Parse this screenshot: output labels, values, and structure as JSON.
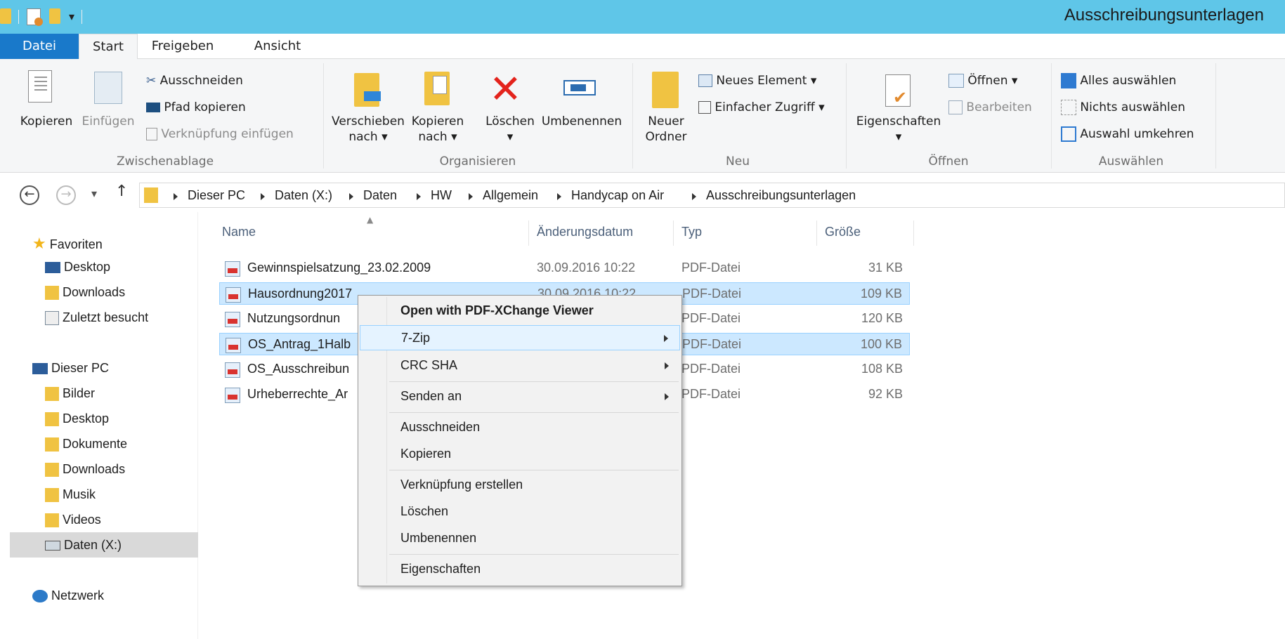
{
  "window": {
    "title": "Ausschreibungsunterlagen"
  },
  "tabs": [
    {
      "label": "Datei"
    },
    {
      "label": "Start"
    },
    {
      "label": "Freigeben"
    },
    {
      "label": "Ansicht"
    }
  ],
  "ribbon": {
    "clipboard": {
      "group": "Zwischenablage",
      "copy": "Kopieren",
      "paste": "Einfügen",
      "cut": "Ausschneiden",
      "copy_path": "Pfad kopieren",
      "paste_shortcut": "Verknüpfung einfügen"
    },
    "organize": {
      "group": "Organisieren",
      "move_to_1": "Verschieben",
      "move_to_2": "nach",
      "copy_to_1": "Kopieren",
      "copy_to_2": "nach",
      "delete": "Löschen",
      "rename": "Umbenennen"
    },
    "new": {
      "group": "Neu",
      "new_folder_1": "Neuer",
      "new_folder_2": "Ordner",
      "new_item": "Neues Element",
      "easy_access": "Einfacher Zugriff"
    },
    "open": {
      "group": "Öffnen",
      "properties": "Eigenschaften",
      "open": "Öffnen",
      "edit": "Bearbeiten"
    },
    "select": {
      "group": "Auswählen",
      "select_all": "Alles auswählen",
      "select_none": "Nichts auswählen",
      "invert": "Auswahl umkehren"
    }
  },
  "address": {
    "crumbs": [
      "Dieser PC",
      "Daten (X:)",
      "Daten",
      "HW",
      "Allgemein",
      "Handycap on Air",
      "Ausschreibungsunterlagen"
    ]
  },
  "nav": {
    "favorites": "Favoriten",
    "fav_items": [
      "Desktop",
      "Downloads",
      "Zuletzt besucht"
    ],
    "this_pc": "Dieser PC",
    "pc_items": [
      "Bilder",
      "Desktop",
      "Dokumente",
      "Downloads",
      "Musik",
      "Videos",
      "Daten (X:)"
    ],
    "network": "Netzwerk"
  },
  "list": {
    "columns": [
      "Name",
      "Änderungsdatum",
      "Typ",
      "Größe"
    ],
    "rows": [
      {
        "name": "Gewinnspielsatzung_23.02.2009",
        "date": "30.09.2016 10:22",
        "type": "PDF-Datei",
        "size": "31 KB"
      },
      {
        "name": "Hausordnung2017",
        "date": "30.09.2016 10:22",
        "type": "PDF-Datei",
        "size": "109 KB"
      },
      {
        "name": "Nutzungsordnun",
        "date": "",
        "type": "PDF-Datei",
        "size": "120 KB"
      },
      {
        "name": "OS_Antrag_1Halb",
        "date": "",
        "type": "PDF-Datei",
        "size": "100 KB"
      },
      {
        "name": "OS_Ausschreibun",
        "date": "",
        "type": "PDF-Datei",
        "size": "108 KB"
      },
      {
        "name": "Urheberrechte_Ar",
        "date": "",
        "type": "PDF-Datei",
        "size": "92 KB"
      }
    ]
  },
  "context_menu": {
    "items": [
      "Open with PDF-XChange Viewer",
      "7-Zip",
      "CRC SHA",
      "Senden an",
      "Ausschneiden",
      "Kopieren",
      "Verknüpfung erstellen",
      "Löschen",
      "Umbenennen",
      "Eigenschaften"
    ]
  },
  "colors": {
    "titlebar": "#5fc6e8",
    "file_tab": "#1979ca",
    "selection": "#cce8ff",
    "folder": "#f0c342"
  }
}
